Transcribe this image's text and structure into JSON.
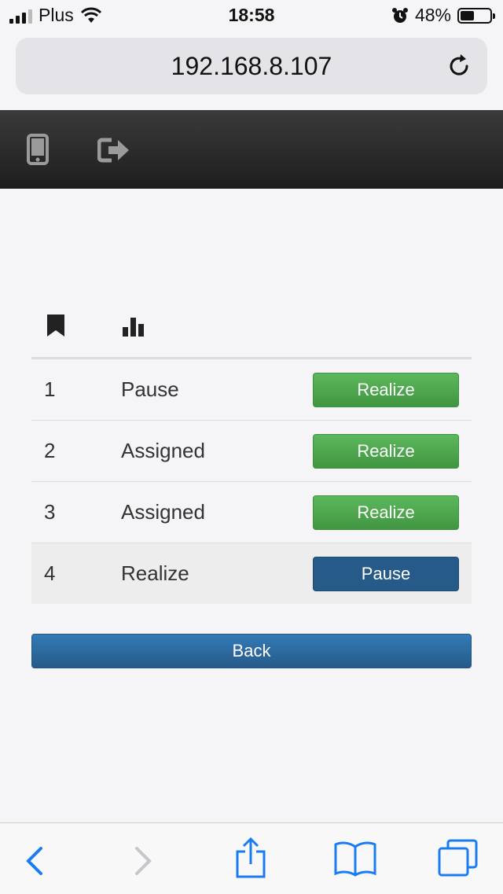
{
  "status_bar": {
    "carrier": "Plus",
    "time": "18:58",
    "battery_percent": "48%",
    "battery_level": 0.48
  },
  "url_bar": {
    "url": "192.168.8.107"
  },
  "navbar": {
    "icons": [
      "mobile-phone-icon",
      "sign-out-icon"
    ]
  },
  "table": {
    "header_icons": [
      "bookmark-icon",
      "bar-chart-icon"
    ],
    "rows": [
      {
        "id": "1",
        "status": "Pause",
        "action": "Realize",
        "action_color": "#4cae4c"
      },
      {
        "id": "2",
        "status": "Assigned",
        "action": "Realize",
        "action_color": "#4cae4c"
      },
      {
        "id": "3",
        "status": "Assigned",
        "action": "Realize",
        "action_color": "#4cae4c"
      },
      {
        "id": "4",
        "status": "Realize",
        "action": "Pause",
        "action_color": "#265a88"
      }
    ]
  },
  "back_button": {
    "label": "Back"
  },
  "toolbar": {
    "icons": [
      "back-icon",
      "forward-icon",
      "share-icon",
      "bookmarks-icon",
      "tabs-icon"
    ]
  }
}
